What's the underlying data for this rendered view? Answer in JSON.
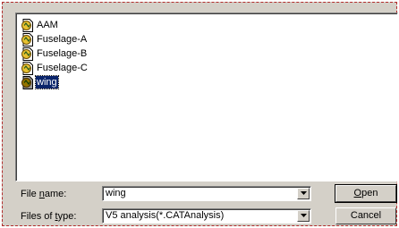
{
  "file_list": {
    "items": [
      {
        "label": "AAM",
        "selected": false
      },
      {
        "label": "Fuselage-A",
        "selected": false
      },
      {
        "label": "Fuselage-B",
        "selected": false
      },
      {
        "label": "Fuselage-C",
        "selected": false
      },
      {
        "label": "wing",
        "selected": true
      }
    ]
  },
  "file_name": {
    "label_prefix": "File ",
    "label_accel": "n",
    "label_suffix": "ame:",
    "value": "wing"
  },
  "file_type": {
    "label_prefix": "Files of ",
    "label_accel": "t",
    "label_suffix": "ype:",
    "value": "V5 analysis(*.CATAnalysis)"
  },
  "buttons": {
    "open_accel": "O",
    "open_rest": "pen",
    "cancel_label": "Cancel"
  },
  "colors": {
    "dialog_bg": "#d4d0c8",
    "selection_bg": "#0a246a",
    "frame_border": "#b22b2b"
  },
  "icons": {
    "file_icon": "catia-analysis-document-icon",
    "dropdown_icon": "chevron-down-icon"
  }
}
